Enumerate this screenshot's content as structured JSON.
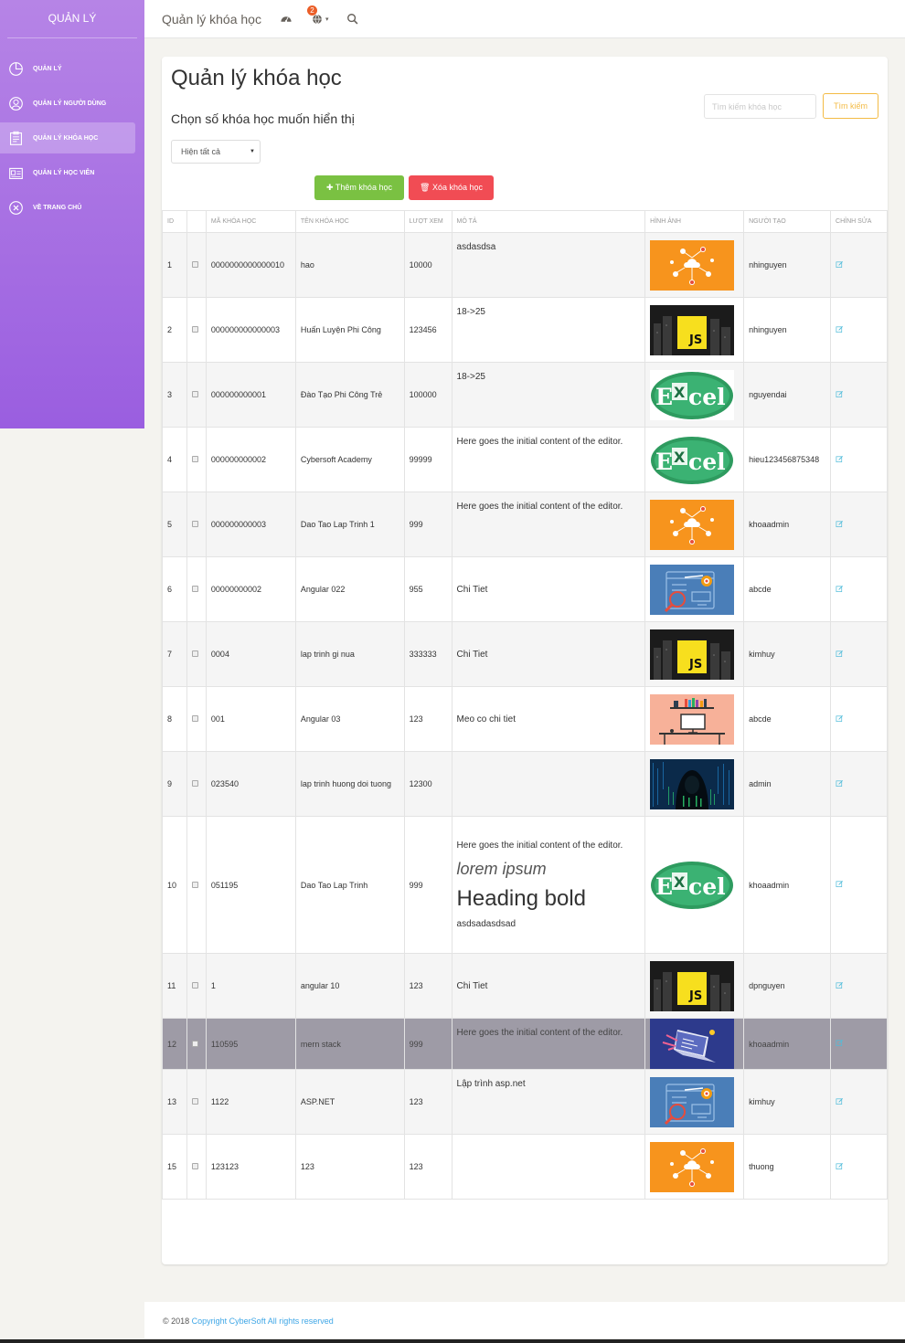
{
  "sidebar": {
    "title": "QUẢN LÝ",
    "items": [
      {
        "label": "QUẢN LÝ",
        "icon": "chart-pie-icon",
        "active": false
      },
      {
        "label": "QUẢN LÝ NGƯỜI DÙNG",
        "icon": "user-icon",
        "active": false
      },
      {
        "label": "QUẢN LÝ KHÓA HỌC",
        "icon": "clipboard-icon",
        "active": true
      },
      {
        "label": "QUẢN LÝ HỌC VIÊN",
        "icon": "id-card-icon",
        "active": false
      },
      {
        "label": "VỀ TRANG CHỦ",
        "icon": "close-circle-icon",
        "active": false
      }
    ]
  },
  "topnav": {
    "title": "Quản lý khóa học",
    "notification_count": "2"
  },
  "page": {
    "title": "Quản lý khóa học",
    "subtitle": "Chọn số khóa học muốn hiển thị",
    "select_value": "Hiện tất cả",
    "search_placeholder": "Tìm kiếm khóa học",
    "search_button": "Tìm kiếm",
    "add_button": "Thêm khóa học",
    "delete_button": "Xóa khóa học"
  },
  "table": {
    "headers": [
      "ID",
      "",
      "MÃ KHÓA HỌC",
      "TÊN KHÓA HỌC",
      "LƯỢT XEM",
      "MÔ TẢ",
      "HÌNH ẢNH",
      "NGƯỜI TẠO",
      "CHỈNH SỬA"
    ],
    "rows": [
      {
        "id": "1",
        "code": "0000000000000010",
        "name": "hao",
        "views": "10000",
        "desc": "asdasdsa",
        "image": "cloud-network",
        "creator": "nhinguyen"
      },
      {
        "id": "2",
        "code": "000000000000003",
        "name": "Huấn Luyện Phi Công",
        "views": "123456",
        "desc": "18->25",
        "image": "js",
        "creator": "nhinguyen"
      },
      {
        "id": "3",
        "code": "000000000001",
        "name": "Đào Tạo Phi Công Trẻ",
        "views": "100000",
        "desc": "18->25",
        "image": "excel",
        "creator": "nguyendai"
      },
      {
        "id": "4",
        "code": "000000000002",
        "name": "Cybersoft Academy",
        "views": "99999",
        "desc": "Here goes the initial content of the editor.",
        "image": "excel",
        "creator": "hieu123456875348"
      },
      {
        "id": "5",
        "code": "000000000003",
        "name": "Dao Tao Lap Trinh 1",
        "views": "999",
        "desc": "Here goes the initial content of the editor.",
        "image": "cloud-network",
        "creator": "khoaadmin"
      },
      {
        "id": "6",
        "code": "00000000002",
        "name": "Angular 022",
        "views": "955",
        "desc": "Chi Tiet",
        "image": "seo",
        "creator": "abcde"
      },
      {
        "id": "7",
        "code": "0004",
        "name": "lap trinh gi nua",
        "views": "333333",
        "desc": "Chi Tiet",
        "image": "js",
        "creator": "kimhuy"
      },
      {
        "id": "8",
        "code": "001",
        "name": "Angular 03",
        "views": "123",
        "desc": "Meo co chi tiet",
        "image": "desk",
        "creator": "abcde"
      },
      {
        "id": "9",
        "code": "023540",
        "name": "lap trinh huong doi tuong",
        "views": "12300",
        "desc": "",
        "image": "hacker",
        "creator": "admin"
      },
      {
        "id": "10",
        "code": "051195",
        "name": "Dao Tao Lap Trinh",
        "views": "999",
        "desc_lines": [
          "Here goes the initial content of the editor.",
          "lorem ipsum",
          "Heading bold",
          "asdsadasdsad"
        ],
        "image": "excel",
        "creator": "khoaadmin"
      },
      {
        "id": "11",
        "code": "1",
        "name": "angular 10",
        "views": "123",
        "desc": "Chi Tiet",
        "image": "js",
        "creator": "dpnguyen"
      },
      {
        "id": "12",
        "code": "110595",
        "name": "mern stack",
        "views": "999",
        "desc": "Here goes the initial content of the editor.",
        "image": "laptop",
        "creator": "khoaadmin",
        "highlight": true
      },
      {
        "id": "13",
        "code": "1122",
        "name": "ASP.NET",
        "views": "123",
        "desc": "Lập trình  asp.net",
        "image": "seo",
        "creator": "kimhuy"
      },
      {
        "id": "15",
        "code": "123123",
        "name": "123",
        "views": "123",
        "desc": "",
        "image": "cloud-network",
        "creator": "thuong"
      }
    ]
  },
  "footer": {
    "prefix": "© 2018 ",
    "link": "Copyright CyberSoft All rights reserved"
  },
  "colors": {
    "sidebar_top": "#b684e6",
    "sidebar_bottom": "#9a5ee0",
    "add_button": "#7ac142",
    "delete_button": "#f14c54",
    "search_button": "#f3bb45",
    "footer_link": "#3ea6e6"
  }
}
